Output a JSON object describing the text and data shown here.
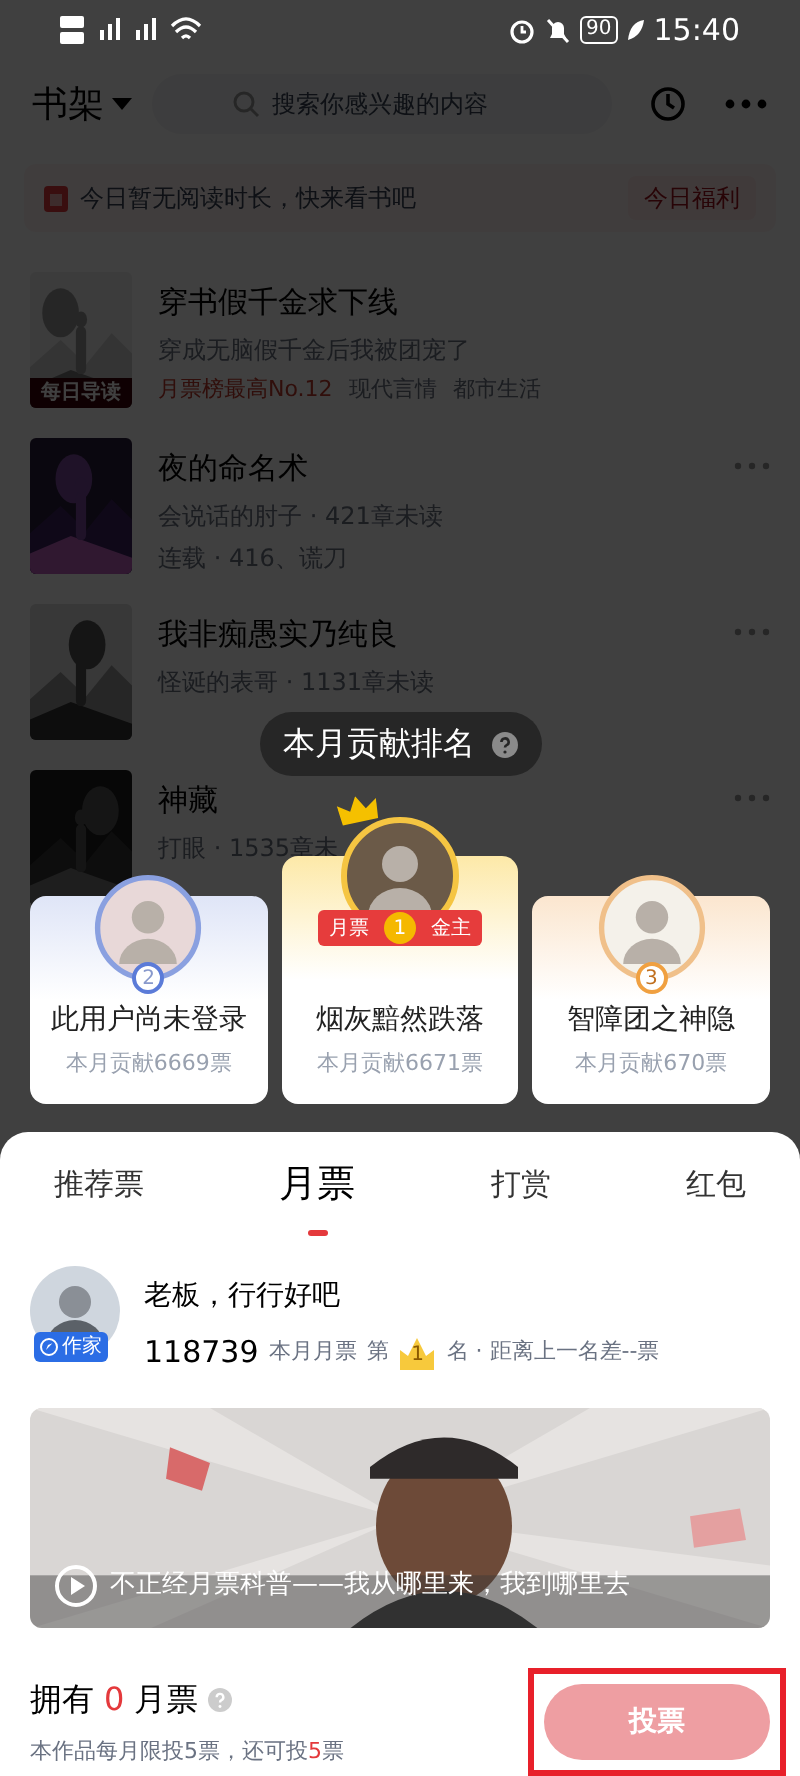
{
  "status_bar": {
    "battery": "90",
    "time": "15:40"
  },
  "header": {
    "title": "书架",
    "search_placeholder": "搜索你感兴趣的内容"
  },
  "banner": {
    "text": "今日暂无阅读时长，快来看书吧",
    "link": "今日福利"
  },
  "books": [
    {
      "title": "穿书假千金求下线",
      "line_2": "穿成无脑假千金后我被团宠了",
      "tags": [
        "月票榜最高No.12",
        "现代言情",
        "都市生活"
      ],
      "badge": "每日导读",
      "has_more": false
    },
    {
      "title": "夜的命名术",
      "line_2": "会说话的肘子 · 421章未读",
      "line_3": "连载 · 416、谎刀",
      "has_more": true
    },
    {
      "title": "我非痴愚实乃纯良",
      "line_2": "怪诞的表哥 · 1131章未读",
      "has_more": true
    },
    {
      "title": "神藏",
      "line_2": "打眼 · 1535章未",
      "has_more": true
    }
  ],
  "ranking": {
    "title": "本月贡献排名",
    "entries": [
      {
        "kind": "silver",
        "rank": "2",
        "name": "此用户尚未登录",
        "contribution": "本月贡献6669票"
      },
      {
        "kind": "gold",
        "rank": "1",
        "name": "烟灰黯然跌落",
        "contribution": "本月贡献6671票",
        "ribbon_left": "月票",
        "ribbon_right": "金主"
      },
      {
        "kind": "bronze",
        "rank": "3",
        "name": "智障团之神隐",
        "contribution": "本月贡献670票"
      }
    ]
  },
  "sheet": {
    "tabs": [
      {
        "label": "推荐票",
        "selected": false
      },
      {
        "label": "月票",
        "selected": true
      },
      {
        "label": "打赏",
        "selected": false
      },
      {
        "label": "红包",
        "selected": false
      }
    ],
    "author": {
      "badge": "作家",
      "message": "老板，行行好吧",
      "votes": "118739",
      "votes_label": "本月月票",
      "rank_prefix": "第",
      "rank": "1",
      "rank_suffix": "名 · 距离上一名差--票"
    },
    "video": {
      "kind": "picture",
      "caption": "不正经月票科普——我从哪里来，我到哪里去"
    },
    "footer": {
      "own_prefix": "拥有",
      "own_count": "0",
      "own_suffix": "月票",
      "note_prefix": "本作品每月限投5票，还可投",
      "note_count": "5",
      "note_suffix": "票"
    },
    "vote_button": {
      "label": "投票",
      "disabled": true,
      "highlighted": true
    }
  }
}
